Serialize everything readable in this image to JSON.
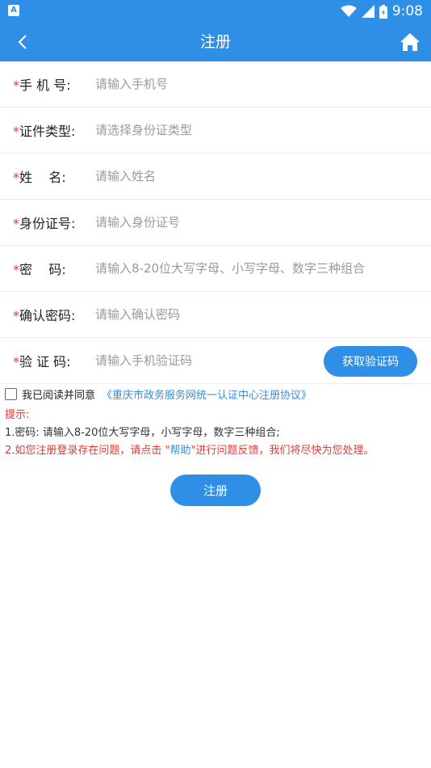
{
  "status_bar": {
    "notification_icon_label": "A",
    "time": "9:08"
  },
  "app_bar": {
    "title": "注册"
  },
  "form": {
    "rows": [
      {
        "label": "手 机 号:",
        "placeholder": "请输入手机号"
      },
      {
        "label": "证件类型:",
        "placeholder": "请选择身份证类型"
      },
      {
        "label": "姓    名:",
        "placeholder": "请输入姓名"
      },
      {
        "label": "身份证号:",
        "placeholder": "请输入身份证号"
      },
      {
        "label": "密    码:",
        "placeholder": "请输入8-20位大写字母、小写字母、数字三种组合"
      },
      {
        "label": "确认密码:",
        "placeholder": "请输入确认密码"
      },
      {
        "label": "验 证 码:",
        "placeholder": "请输入手机验证码"
      }
    ],
    "required_mark": "*",
    "get_code_label": "获取验证码"
  },
  "agreement": {
    "text": "我已阅读并同意",
    "link": "《重庆市政务服务网统一认证中心注册协议》",
    "checked": false
  },
  "tips": {
    "title": "提示:",
    "line1": "1.密码: 请输入8-20位大写字母，小写字母，数字三种组合;",
    "line2_prefix": "2.如您注册登录存在问题，请点击 \"",
    "line2_help": "帮助",
    "line2_suffix": "\"进行问题反馈，我们将尽快为您处理。"
  },
  "submit_label": "注册",
  "colors": {
    "primary": "#2f8fe6",
    "required": "#e53935"
  }
}
